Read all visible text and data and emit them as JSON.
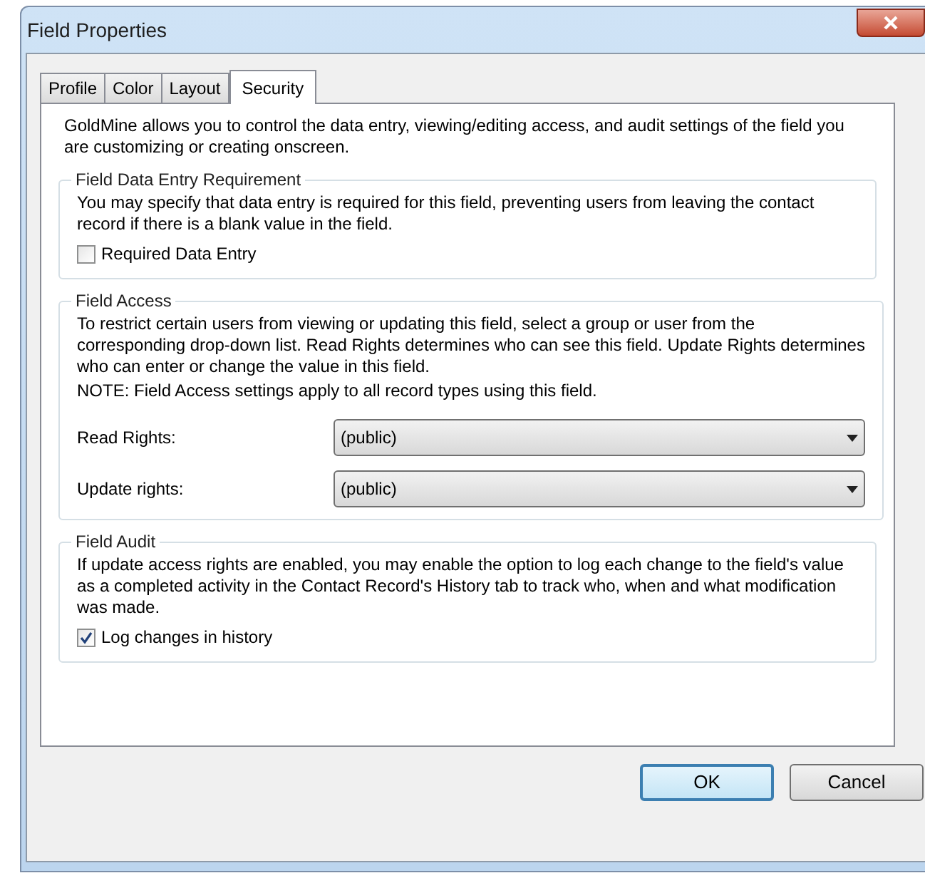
{
  "window": {
    "title": "Field Properties"
  },
  "tabs": [
    {
      "label": "Profile",
      "selected": false
    },
    {
      "label": "Color",
      "selected": false
    },
    {
      "label": "Layout",
      "selected": false
    },
    {
      "label": "Security",
      "selected": true
    }
  ],
  "intro": "GoldMine allows you to control the data entry, viewing/editing access, and audit settings of the field you are customizing or creating onscreen.",
  "groups": [
    {
      "title": "Field Data Entry Requirement",
      "paragraphs": [
        "You may specify that data entry is required for this field, preventing users from leaving the contact record if there is a blank value in the field."
      ],
      "checkbox": {
        "label": "Required Data Entry",
        "checked": false
      }
    },
    {
      "title": "Field Access",
      "paragraphs": [
        "To restrict certain users from viewing or updating this field, select a group or user from the corresponding drop-down list.  Read Rights determines who can see this field.  Update Rights determines who can enter or change the value in this field.",
        "NOTE: Field Access settings apply to all record types using this field."
      ],
      "dropdowns": [
        {
          "label": "Read Rights:",
          "value": "(public)"
        },
        {
          "label": "Update rights:",
          "value": "(public)"
        }
      ]
    },
    {
      "title": "Field Audit",
      "paragraphs": [
        "If update access rights are enabled, you may enable the option to log each change to the field's value as a completed activity in the Contact Record's History tab to track who, when and what modification was made."
      ],
      "checkbox": {
        "label": "Log changes in history",
        "checked": true
      }
    }
  ],
  "buttons": [
    {
      "label": "OK",
      "kind": "default"
    },
    {
      "label": "Cancel",
      "kind": "normal"
    }
  ]
}
